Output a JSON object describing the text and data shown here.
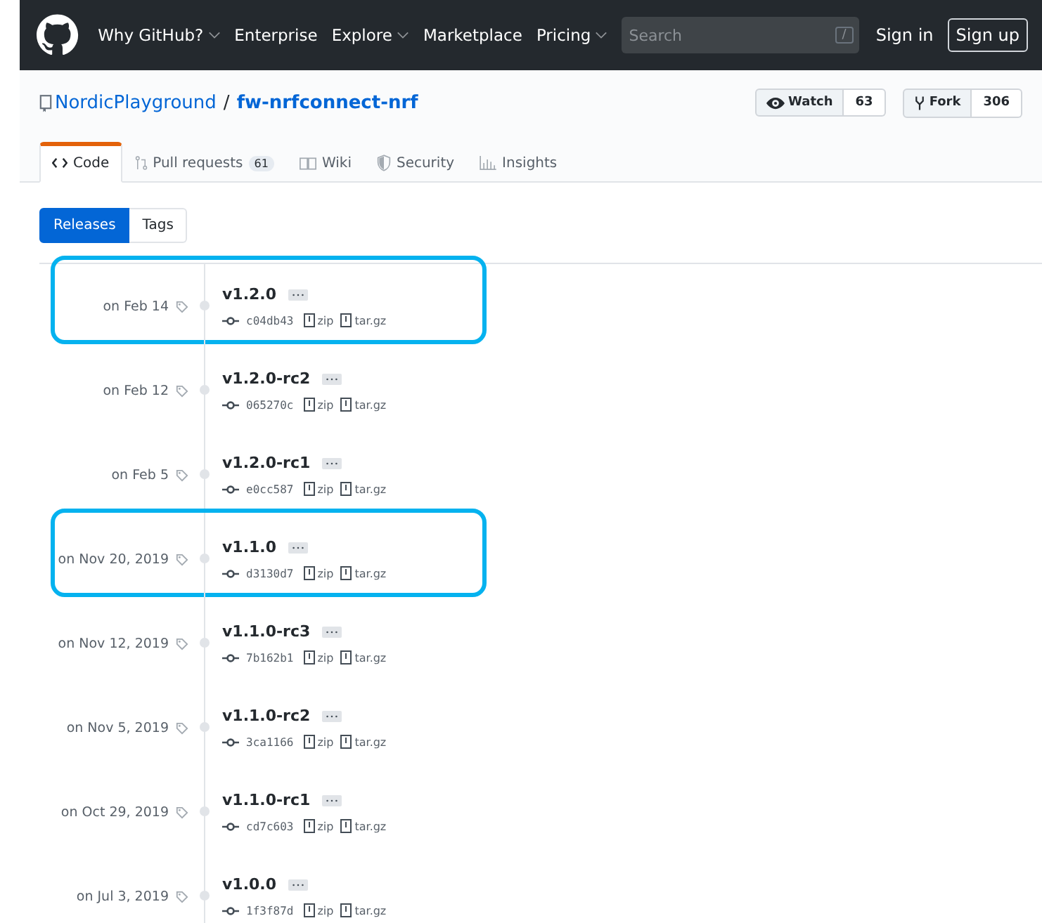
{
  "header": {
    "nav": [
      {
        "label": "Why GitHub?",
        "dropdown": true
      },
      {
        "label": "Enterprise",
        "dropdown": false
      },
      {
        "label": "Explore",
        "dropdown": true
      },
      {
        "label": "Marketplace",
        "dropdown": false
      },
      {
        "label": "Pricing",
        "dropdown": true
      }
    ],
    "search": {
      "placeholder": "Search",
      "shortcut": "/"
    },
    "sign_in": "Sign in",
    "sign_up": "Sign up"
  },
  "repo": {
    "owner": "NordicPlayground",
    "separator": "/",
    "name": "fw-nrfconnect-nrf",
    "watch": {
      "label": "Watch",
      "count": "63"
    },
    "fork": {
      "label": "Fork",
      "count": "306"
    }
  },
  "tabs": [
    {
      "label": "Code",
      "selected": true
    },
    {
      "label": "Pull requests",
      "count": "61",
      "selected": false
    },
    {
      "label": "Wiki",
      "selected": false
    },
    {
      "label": "Security",
      "selected": false
    },
    {
      "label": "Insights",
      "selected": false
    }
  ],
  "switch": [
    {
      "label": "Releases",
      "selected": true
    },
    {
      "label": "Tags",
      "selected": false
    }
  ],
  "releases": [
    {
      "date": "on Feb 14",
      "tag": "v1.2.0",
      "commit": "c04db43",
      "zip": "zip",
      "tar": "tar.gz",
      "highlighted": true
    },
    {
      "date": "on Feb 12",
      "tag": "v1.2.0-rc2",
      "commit": "065270c",
      "zip": "zip",
      "tar": "tar.gz",
      "highlighted": false
    },
    {
      "date": "on Feb 5",
      "tag": "v1.2.0-rc1",
      "commit": "e0cc587",
      "zip": "zip",
      "tar": "tar.gz",
      "highlighted": false
    },
    {
      "date": "on Nov 20, 2019",
      "tag": "v1.1.0",
      "commit": "d3130d7",
      "zip": "zip",
      "tar": "tar.gz",
      "highlighted": true
    },
    {
      "date": "on Nov 12, 2019",
      "tag": "v1.1.0-rc3",
      "commit": "7b162b1",
      "zip": "zip",
      "tar": "tar.gz",
      "highlighted": false
    },
    {
      "date": "on Nov 5, 2019",
      "tag": "v1.1.0-rc2",
      "commit": "3ca1166",
      "zip": "zip",
      "tar": "tar.gz",
      "highlighted": false
    },
    {
      "date": "on Oct 29, 2019",
      "tag": "v1.1.0-rc1",
      "commit": "cd7c603",
      "zip": "zip",
      "tar": "tar.gz",
      "highlighted": false
    },
    {
      "date": "on Jul 3, 2019",
      "tag": "v1.0.0",
      "commit": "1f3f87d",
      "zip": "zip",
      "tar": "tar.gz",
      "highlighted": false
    }
  ]
}
